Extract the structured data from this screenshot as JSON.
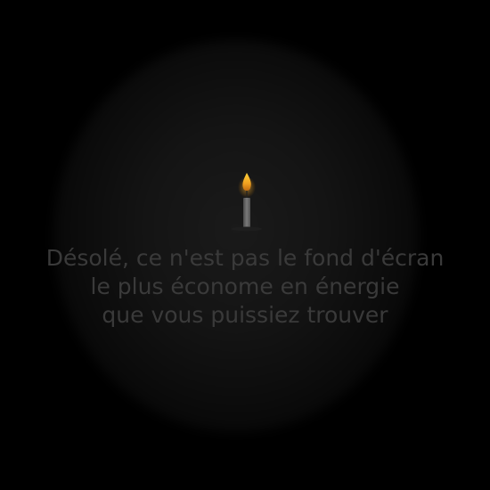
{
  "message": {
    "line1": "Désolé, ce n'est pas le fond d'écran",
    "line2": "le plus économe en énergie",
    "line3": "que vous puissiez trouver"
  },
  "icons": {
    "candle": "candle-icon"
  },
  "colors": {
    "background": "#000000",
    "text": "#3a3a3a",
    "flame": "#f0a020",
    "candle_body": "#6e6e6e"
  }
}
